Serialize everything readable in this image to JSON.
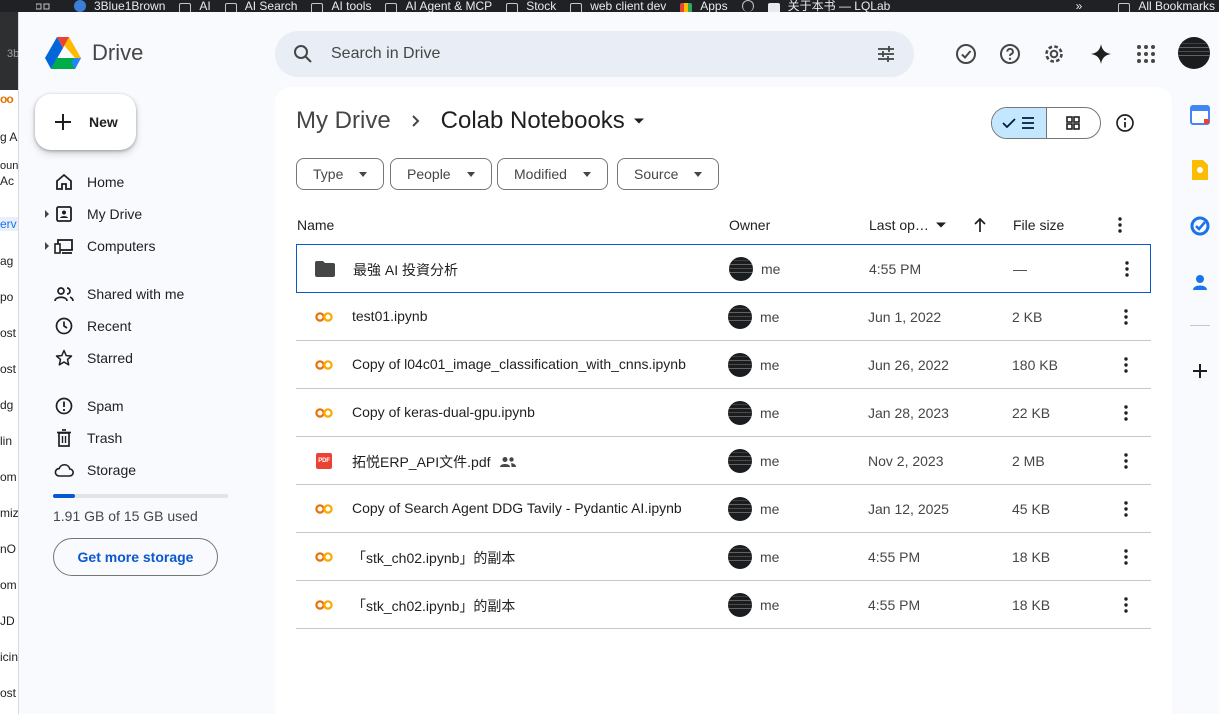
{
  "bookmarks": [
    "3Blue1Brown",
    "AI",
    "AI Search",
    "AI tools",
    "AI Agent & MCP",
    "Stock",
    "web client dev",
    "Apps",
    "",
    "关于本书 — LQLab"
  ],
  "bookmarks_more": "»",
  "bookmarks_all": "All Bookmarks",
  "left_strip": [
    "3b",
    "oo",
    "g  A",
    "oun",
    "Ac",
    "erv",
    "ag",
    "po",
    "ost",
    "ost",
    "dg",
    "lin",
    "om",
    "miz",
    "nO",
    "om",
    "JD a",
    "icin",
    "ost"
  ],
  "app": {
    "name": "Drive"
  },
  "search": {
    "placeholder": "Search in Drive"
  },
  "sidebar": {
    "new_label": "New",
    "items": [
      {
        "label": "Home",
        "icon": "home-icon"
      },
      {
        "label": "My Drive",
        "icon": "my-drive-icon"
      },
      {
        "label": "Computers",
        "icon": "computers-icon"
      },
      {
        "label": "Shared with me",
        "icon": "shared-icon"
      },
      {
        "label": "Recent",
        "icon": "clock-icon"
      },
      {
        "label": "Starred",
        "icon": "star-icon"
      },
      {
        "label": "Spam",
        "icon": "spam-icon"
      },
      {
        "label": "Trash",
        "icon": "trash-icon"
      },
      {
        "label": "Storage",
        "icon": "cloud-icon"
      }
    ],
    "storage_text": "1.91 GB of 15 GB used",
    "storage_used_fraction": 0.127,
    "get_storage_label": "Get more storage"
  },
  "breadcrumb": {
    "parent": "My Drive",
    "current": "Colab Notebooks"
  },
  "filters": [
    "Type",
    "People",
    "Modified",
    "Source"
  ],
  "columns": {
    "name": "Name",
    "owner": "Owner",
    "last_opened": "Last op…",
    "size": "File size"
  },
  "files": [
    {
      "name": "最強 AI 投資分析",
      "type": "folder",
      "owner": "me",
      "date": "4:55 PM",
      "size": "—",
      "shared": false,
      "selected": true
    },
    {
      "name": "test01.ipynb",
      "type": "colab",
      "owner": "me",
      "date": "Jun 1, 2022",
      "size": "2 KB",
      "shared": false,
      "selected": false
    },
    {
      "name": "Copy of l04c01_image_classification_with_cnns.ipynb",
      "type": "colab",
      "owner": "me",
      "date": "Jun 26, 2022",
      "size": "180 KB",
      "shared": false,
      "selected": false
    },
    {
      "name": "Copy of keras-dual-gpu.ipynb",
      "type": "colab",
      "owner": "me",
      "date": "Jan 28, 2023",
      "size": "22 KB",
      "shared": false,
      "selected": false
    },
    {
      "name": "拓悦ERP_API文件.pdf",
      "type": "pdf",
      "owner": "me",
      "date": "Nov 2, 2023",
      "size": "2 MB",
      "shared": true,
      "selected": false
    },
    {
      "name": "Copy of Search Agent DDG Tavily - Pydantic AI.ipynb",
      "type": "colab",
      "owner": "me",
      "date": "Jan 12, 2025",
      "size": "45 KB",
      "shared": false,
      "selected": false
    },
    {
      "name": "「stk_ch02.ipynb」的副本",
      "type": "colab",
      "owner": "me",
      "date": "4:55 PM",
      "size": "18 KB",
      "shared": false,
      "selected": false
    },
    {
      "name": "「stk_ch02.ipynb」的副本",
      "type": "colab",
      "owner": "me",
      "date": "4:55 PM",
      "size": "18 KB",
      "shared": false,
      "selected": false
    }
  ],
  "pdf_badge": "PDF",
  "colors": {
    "accent": "#0b57d0",
    "selected_view": "#c2e7ff",
    "search_bg": "#e9eef6",
    "colab_orange": "#f9ab00",
    "pdf_red": "#ea4335"
  }
}
